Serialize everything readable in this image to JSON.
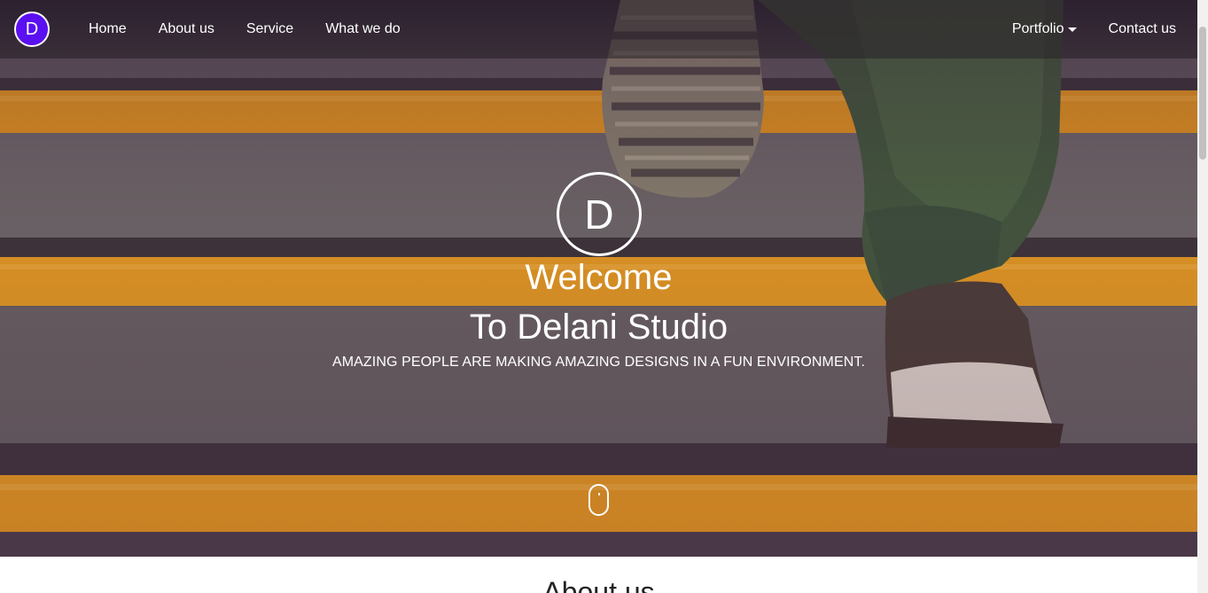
{
  "navbar": {
    "brand_letter": "D",
    "left_links": [
      "Home",
      "About us",
      "Service",
      "What we do"
    ],
    "portfolio_label": "Portfolio",
    "contact_label": "Contact us"
  },
  "hero": {
    "logo_letter": "D",
    "title_line1": "Welcome",
    "title_line2": "To Delani Studio",
    "tagline": "AMAZING PEOPLE ARE MAKING AMAZING DESIGNS IN A FUN ENVIRONMENT."
  },
  "about": {
    "heading": "About us"
  },
  "colors": {
    "brand_purple": "#5a10f0",
    "stair_yellow": "#f2a41a",
    "text_white": "#ffffff"
  },
  "icons": {
    "scroll_indicator": "mouse-scroll-icon",
    "dropdown": "caret-down-icon"
  }
}
